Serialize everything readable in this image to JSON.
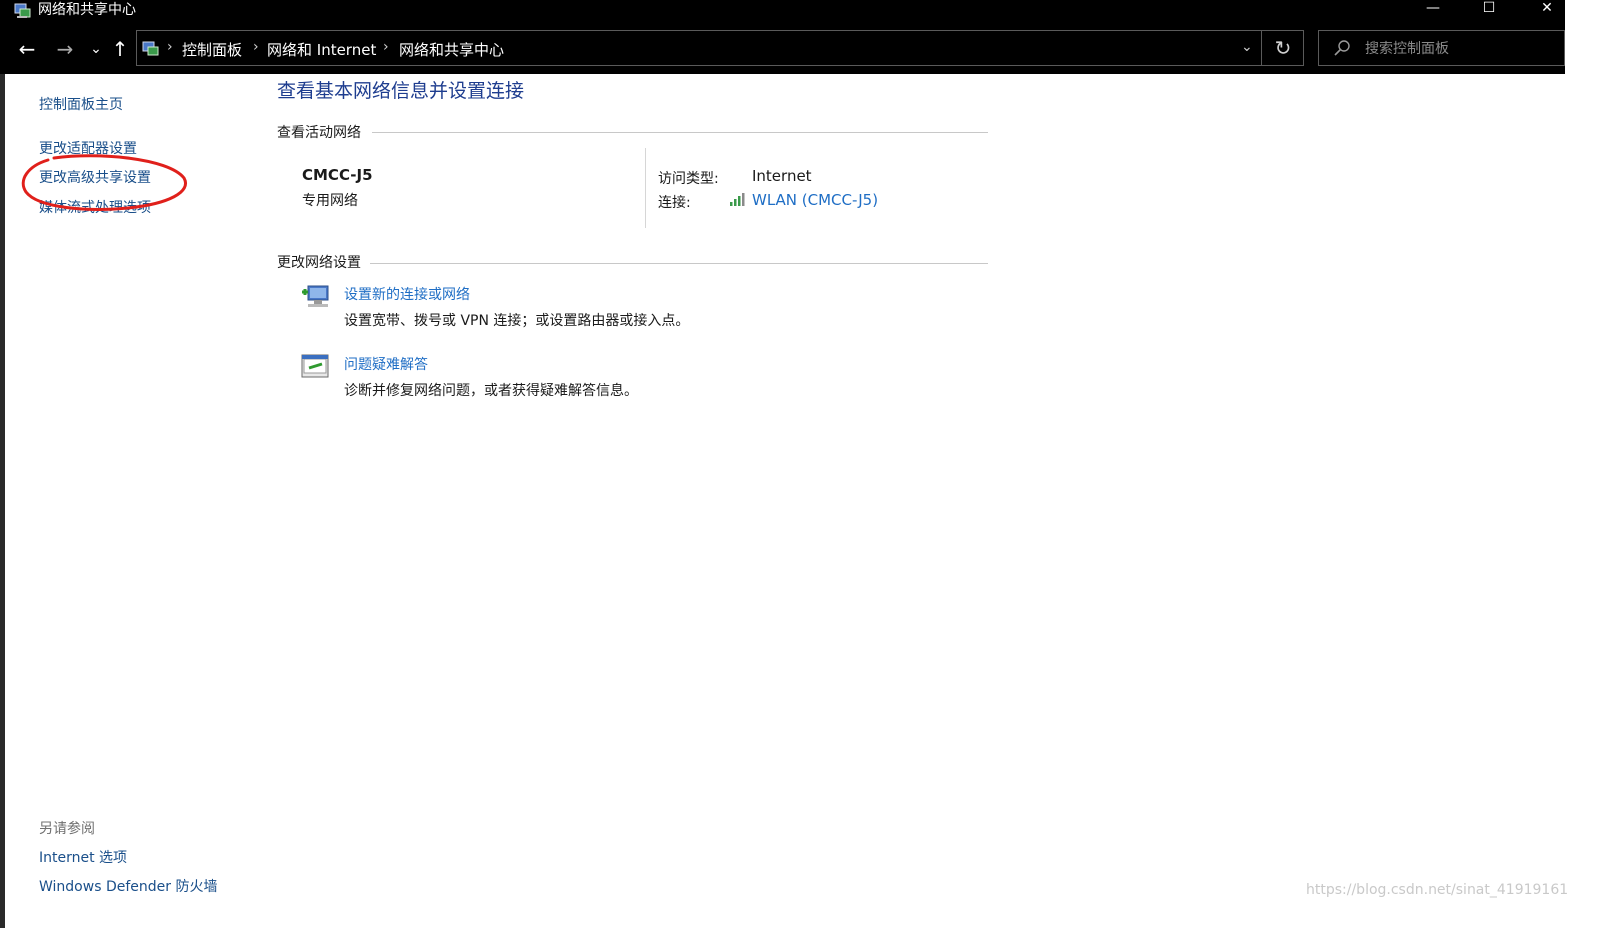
{
  "window": {
    "title": "网络和共享中心",
    "minimize": "—",
    "maximize": "☐",
    "close": "✕"
  },
  "nav": {
    "back": "←",
    "forward": "→",
    "recent": "⌄",
    "up": "↑"
  },
  "address": {
    "crumbs": [
      "控制面板",
      "网络和 Internet",
      "网络和共享中心"
    ],
    "separator": "›",
    "dropdown": "⌄",
    "refresh": "↻"
  },
  "search": {
    "placeholder": "搜索控制面板"
  },
  "sidebar": {
    "items": [
      {
        "label": "控制面板主页"
      },
      {
        "label": "更改适配器设置"
      },
      {
        "label": "更改高级共享设置"
      },
      {
        "label": "媒体流式处理选项"
      }
    ],
    "see_also": {
      "heading": "另请参阅",
      "items": [
        {
          "label": "Internet 选项"
        },
        {
          "label": "Windows Defender 防火墙"
        }
      ]
    }
  },
  "main": {
    "title": "查看基本网络信息并设置连接",
    "active_networks": {
      "heading": "查看活动网络",
      "network_name": "CMCC-J5",
      "network_type": "专用网络",
      "access_type_label": "访问类型:",
      "access_type_value": "Internet",
      "connection_label": "连接:",
      "connection_value": "WLAN (CMCC-J5)"
    },
    "change_settings": {
      "heading": "更改网络设置",
      "tasks": [
        {
          "title": "设置新的连接或网络",
          "description": "设置宽带、拨号或 VPN 连接；或设置路由器或接入点。",
          "icon": "new-connection-icon"
        },
        {
          "title": "问题疑难解答",
          "description": "诊断并修复网络问题，或者获得疑难解答信息。",
          "icon": "troubleshoot-icon"
        }
      ]
    }
  },
  "watermark": "https://blog.csdn.net/sinat_41919161",
  "colors": {
    "link": "#1f6ec5",
    "title": "#1e3d8f",
    "annotation": "#e0201b"
  }
}
